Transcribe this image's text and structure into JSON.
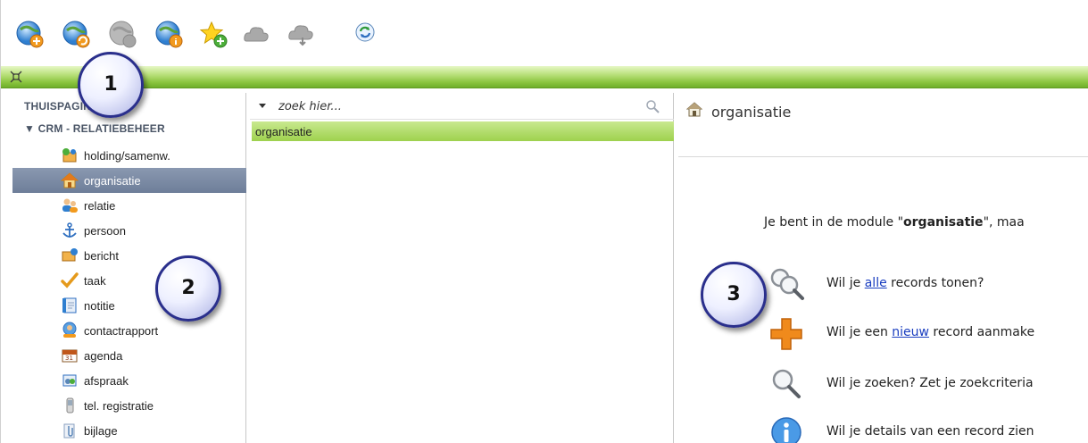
{
  "toolbar": {
    "buttons": [
      {
        "icon": "globe-add-icon",
        "enabled": true
      },
      {
        "icon": "globe-refresh-icon",
        "enabled": true
      },
      {
        "icon": "globe-disabled-icon",
        "enabled": false
      },
      {
        "icon": "globe-info-icon",
        "enabled": true
      },
      {
        "icon": "star-add-icon",
        "enabled": true
      },
      {
        "icon": "cloud-disabled-icon",
        "enabled": false
      },
      {
        "icon": "cloud-arrow-disabled-icon",
        "enabled": false
      },
      {
        "icon": "sync-icon",
        "enabled": true
      }
    ]
  },
  "sidebar": {
    "home_label": "THUISPAGINA",
    "section_label": "▼ CRM - RELATIEBEHEER",
    "items": [
      {
        "label": "holding/samenw.",
        "icon": "holding-icon"
      },
      {
        "label": "organisatie",
        "icon": "house-icon",
        "active": true
      },
      {
        "label": "relatie",
        "icon": "people-icon"
      },
      {
        "label": "persoon",
        "icon": "anchor-icon"
      },
      {
        "label": "bericht",
        "icon": "message-icon"
      },
      {
        "label": "taak",
        "icon": "check-icon"
      },
      {
        "label": "notitie",
        "icon": "notebook-icon"
      },
      {
        "label": "contactrapport",
        "icon": "contact-icon"
      },
      {
        "label": "agenda",
        "icon": "calendar-icon"
      },
      {
        "label": "afspraak",
        "icon": "appointment-icon"
      },
      {
        "label": "tel. registratie",
        "icon": "phone-icon"
      },
      {
        "label": "bijlage",
        "icon": "attachment-icon"
      }
    ]
  },
  "middle": {
    "search_placeholder": "zoek hier...",
    "result": "organisatie"
  },
  "right": {
    "title": "organisatie",
    "intro_prefix": "Je bent in de module \"",
    "intro_bold": "organisatie",
    "intro_suffix": "\", maa",
    "rows": [
      {
        "before": "Wil je ",
        "link": "alle",
        "after": " records tonen?",
        "icon": "search-records-icon"
      },
      {
        "before": "Wil je een ",
        "link": "nieuw",
        "after": " record aanmake",
        "icon": "plus-icon"
      },
      {
        "before": "Wil je zoeken? Zet je zoekcriteria",
        "link": "",
        "after": "",
        "icon": "magnifier-icon"
      },
      {
        "before": "Wil je details van een record zien",
        "link": "",
        "after": "",
        "icon": "info-icon"
      }
    ]
  },
  "callouts": [
    "1",
    "2",
    "3"
  ],
  "colors": {
    "green_bar": "#8bc53f",
    "active_item": "#7a89a3",
    "result_highlight": "#aedb5f",
    "link": "#1a3ec0",
    "callout_border": "#2a2f8c"
  }
}
